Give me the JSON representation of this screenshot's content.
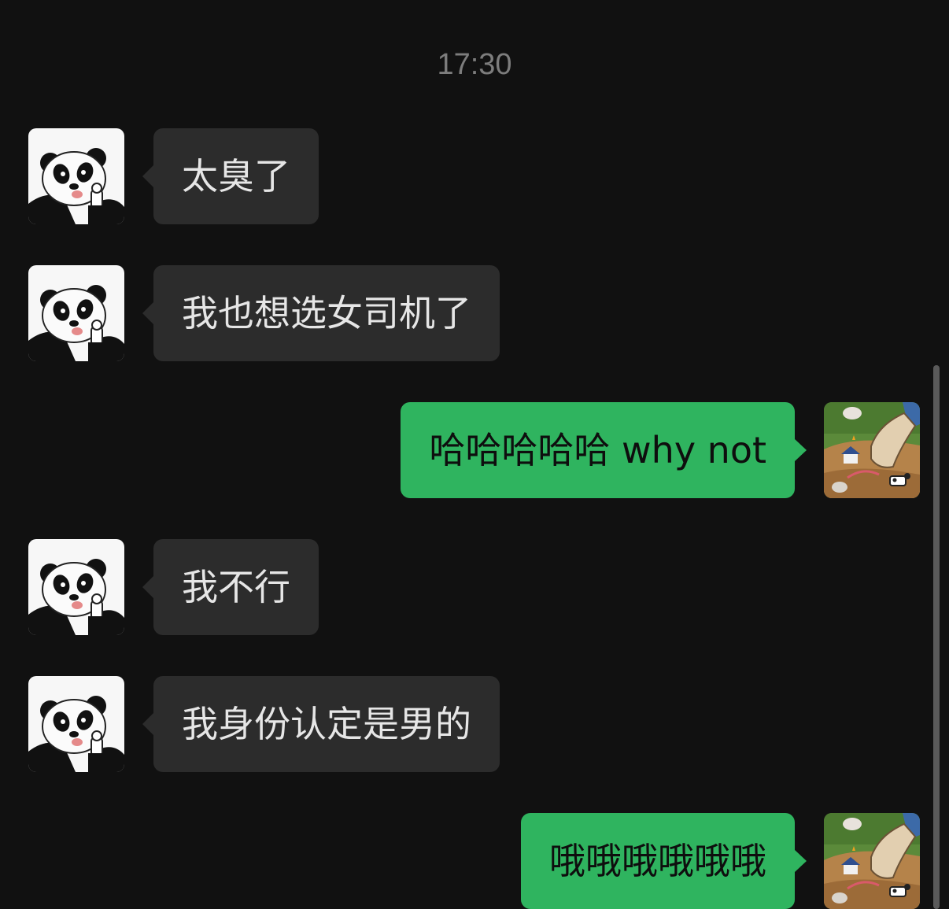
{
  "chat": {
    "timestamp": "17:30",
    "messages": [
      {
        "side": "in",
        "text": "太臭了",
        "avatar": "panda-avatar"
      },
      {
        "side": "in",
        "text": "我也想选女司机了",
        "avatar": "panda-avatar"
      },
      {
        "side": "out",
        "text": "哈哈哈哈哈 why not",
        "avatar": "stomping-shoe-avatar"
      },
      {
        "side": "in",
        "text": "我不行",
        "avatar": "panda-avatar"
      },
      {
        "side": "in",
        "text": "我身份认定是男的",
        "avatar": "panda-avatar"
      },
      {
        "side": "out",
        "text": "哦哦哦哦哦哦",
        "avatar": "stomping-shoe-avatar"
      }
    ]
  },
  "colors": {
    "background": "#111111",
    "incoming_bubble": "#2c2c2c",
    "outgoing_bubble": "#2fb45f",
    "timestamp_text": "#7d7d7d"
  }
}
